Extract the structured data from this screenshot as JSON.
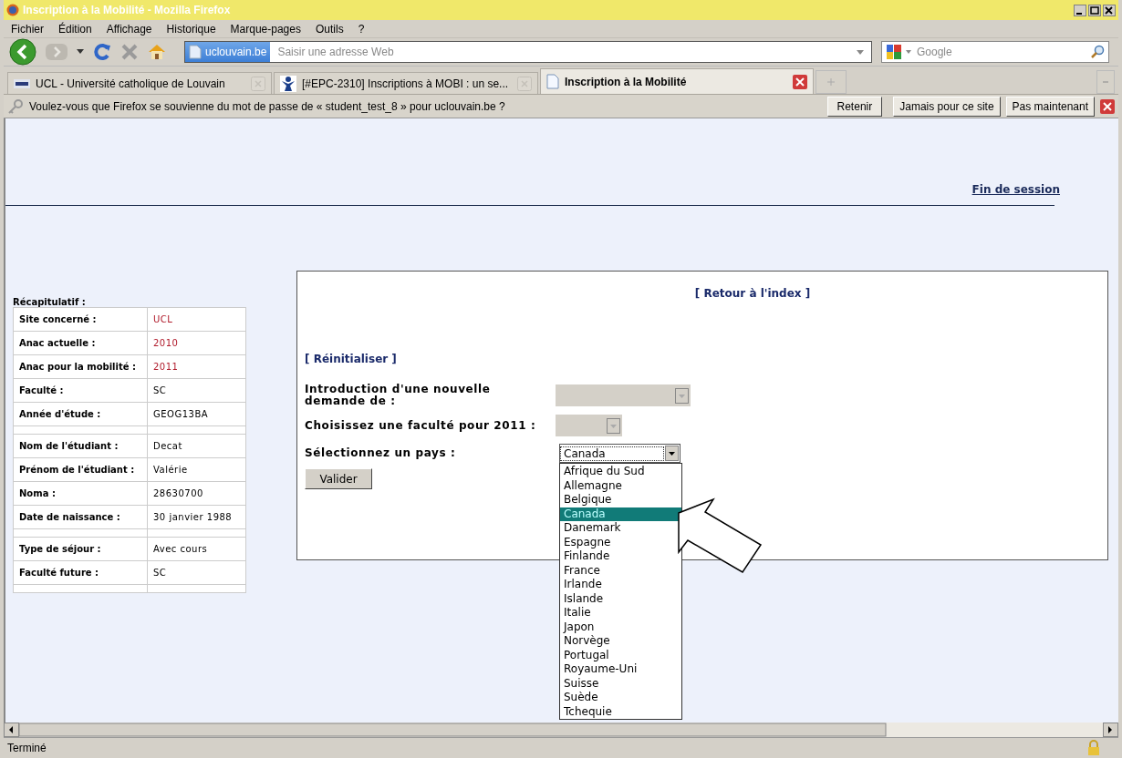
{
  "window": {
    "title": "Inscription à la Mobilité - Mozilla Firefox"
  },
  "menu": [
    "Fichier",
    "Édition",
    "Affichage",
    "Historique",
    "Marque-pages",
    "Outils",
    "?"
  ],
  "toolbar": {
    "site_badge": "uclouvain.be",
    "address_placeholder": "Saisir une adresse Web",
    "search_placeholder": "Google"
  },
  "tabs": [
    {
      "label": "UCL - Université catholique de Louvain",
      "kind": "ucl",
      "selected": false
    },
    {
      "label": "[#EPC-2310] Inscriptions à MOBI : un se...",
      "kind": "person",
      "selected": false
    },
    {
      "label": "Inscription à la Mobilité",
      "kind": "page",
      "selected": true
    }
  ],
  "notification": {
    "message": "Voulez-vous que Firefox se souvienne du mot de passe de « student_test_8 » pour uclouvain.be ?",
    "buttons": [
      "Retenir",
      "Jamais pour ce site",
      "Pas maintenant"
    ]
  },
  "page": {
    "logout_link": "Fin de session",
    "summary": {
      "title": "Récapitulatif :",
      "rows": [
        {
          "kind": "field",
          "label": "Site concerné :",
          "value": "UCL",
          "emphasized": true
        },
        {
          "kind": "field",
          "label": "Anac actuelle :",
          "value": "2010",
          "emphasized": true
        },
        {
          "kind": "field",
          "label": "Anac pour la mobilité :",
          "value": "2011",
          "emphasized": true
        },
        {
          "kind": "field",
          "label": "Faculté :",
          "value": "SC",
          "emphasized": false
        },
        {
          "kind": "field",
          "label": "Année d'étude :",
          "value": "GEOG13BA",
          "emphasized": false
        },
        {
          "kind": "spacer"
        },
        {
          "kind": "field",
          "label": "Nom de l'étudiant :",
          "value": "Decat",
          "emphasized": false
        },
        {
          "kind": "field",
          "label": "Prénom de l'étudiant :",
          "value": "Valérie",
          "emphasized": false
        },
        {
          "kind": "field",
          "label": "Noma :",
          "value": "28630700",
          "emphasized": false
        },
        {
          "kind": "field",
          "label": "Date de naissance :",
          "value": "30 janvier 1988",
          "emphasized": false
        },
        {
          "kind": "spacer"
        },
        {
          "kind": "field",
          "label": "Type de séjour :",
          "value": "Avec cours",
          "emphasized": false
        },
        {
          "kind": "field",
          "label": "Faculté future :",
          "value": "SC",
          "emphasized": false
        },
        {
          "kind": "spacer"
        }
      ]
    },
    "form": {
      "back_link": "[ Retour à l'index ]",
      "reset_link": "[ Réinitialiser ]",
      "fields": [
        {
          "label": "Introduction d'une nouvelle demande de :",
          "disabled": true,
          "expanded": false
        },
        {
          "label": "Choisissez une faculté pour 2011 :",
          "disabled": true,
          "expanded": false
        },
        {
          "label": "Sélectionnez un pays :",
          "disabled": false,
          "expanded": true,
          "value": "Canada",
          "options": [
            {
              "label": "Afrique du Sud",
              "selected": false
            },
            {
              "label": "Allemagne",
              "selected": false
            },
            {
              "label": "Belgique",
              "selected": false
            },
            {
              "label": "Canada",
              "selected": true
            },
            {
              "label": "Danemark",
              "selected": false
            },
            {
              "label": "Espagne",
              "selected": false
            },
            {
              "label": "Finlande",
              "selected": false
            },
            {
              "label": "France",
              "selected": false
            },
            {
              "label": "Irlande",
              "selected": false
            },
            {
              "label": "Islande",
              "selected": false
            },
            {
              "label": "Italie",
              "selected": false
            },
            {
              "label": "Japon",
              "selected": false
            },
            {
              "label": "Norvège",
              "selected": false
            },
            {
              "label": "Portugal",
              "selected": false
            },
            {
              "label": "Royaume-Uni",
              "selected": false
            },
            {
              "label": "Suisse",
              "selected": false
            },
            {
              "label": "Suède",
              "selected": false
            },
            {
              "label": "Tchequie",
              "selected": false
            }
          ]
        }
      ],
      "submit": "Valider"
    }
  },
  "status_bar": {
    "text": "Terminé"
  }
}
